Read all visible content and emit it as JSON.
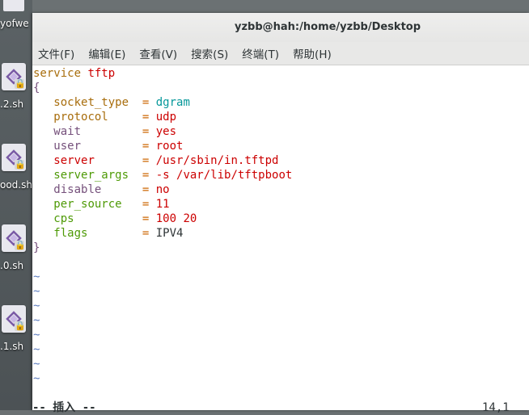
{
  "desktop": {
    "top_label": "yofwe",
    "icons": [
      {
        "label": ".2.sh"
      },
      {
        "label": "ood.sh"
      },
      {
        "label": ".0.sh"
      },
      {
        "label": ".1.sh"
      }
    ]
  },
  "window": {
    "title": "yzbb@hah:/home/yzbb/Desktop"
  },
  "menubar": {
    "items": [
      {
        "label": "文件(F)"
      },
      {
        "label": "编辑(E)"
      },
      {
        "label": "查看(V)"
      },
      {
        "label": "搜索(S)"
      },
      {
        "label": "终端(T)"
      },
      {
        "label": "帮助(H)"
      }
    ]
  },
  "editor": {
    "service_keyword": "service",
    "service_name": "tftp",
    "open_brace": "{",
    "close_brace": "}",
    "entries": [
      {
        "key": "socket_type",
        "value": "dgram"
      },
      {
        "key": "protocol",
        "value": "udp"
      },
      {
        "key": "wait",
        "value": "yes"
      },
      {
        "key": "user",
        "value": "root"
      },
      {
        "key": "server",
        "value": "/usr/sbin/in.tftpd"
      },
      {
        "key": "server_args",
        "value": "-s /var/lib/tftpboot"
      },
      {
        "key": "disable",
        "value": "no"
      },
      {
        "key": "per_source",
        "value": "11"
      },
      {
        "key": "cps",
        "value": "100 20"
      },
      {
        "key": "flags",
        "value": "IPV4"
      }
    ],
    "tilde": "~",
    "status_mode": "-- 插入 --",
    "status_position": "14,1"
  },
  "colors": {
    "keyword": "#a86d0c",
    "string": "#cc0000",
    "tilde": "#5c7cbf",
    "eq": "#cc6600"
  }
}
